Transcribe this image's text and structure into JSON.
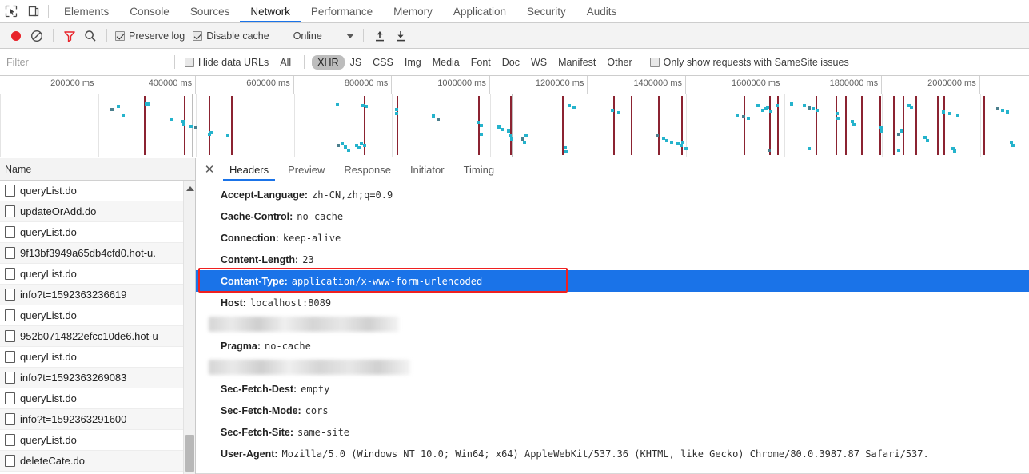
{
  "devtools": {
    "icons": {
      "inspect": "inspect-cursor-icon",
      "device": "device-toolbar-icon"
    },
    "tabs": [
      {
        "label": "Elements",
        "active": false
      },
      {
        "label": "Console",
        "active": false
      },
      {
        "label": "Sources",
        "active": false
      },
      {
        "label": "Network",
        "active": true
      },
      {
        "label": "Performance",
        "active": false
      },
      {
        "label": "Memory",
        "active": false
      },
      {
        "label": "Application",
        "active": false
      },
      {
        "label": "Security",
        "active": false
      },
      {
        "label": "Audits",
        "active": false
      }
    ]
  },
  "toolbar": {
    "record_label": "record-button",
    "clear_label": "clear-button",
    "filter_label": "filter-toggle-button",
    "search_label": "search-button",
    "preserve_log": {
      "label": "Preserve log",
      "checked": true
    },
    "disable_cache": {
      "label": "Disable cache",
      "checked": true
    },
    "throttling": {
      "value": "Online"
    },
    "import_label": "import-har-button",
    "export_label": "export-har-button"
  },
  "filterbar": {
    "placeholder": "Filter",
    "value": "",
    "hide_data_urls": {
      "label": "Hide data URLs",
      "checked": false
    },
    "types": [
      {
        "label": "All",
        "active": false
      },
      {
        "label": "XHR",
        "active": true
      },
      {
        "label": "JS",
        "active": false
      },
      {
        "label": "CSS",
        "active": false
      },
      {
        "label": "Img",
        "active": false
      },
      {
        "label": "Media",
        "active": false
      },
      {
        "label": "Font",
        "active": false
      },
      {
        "label": "Doc",
        "active": false
      },
      {
        "label": "WS",
        "active": false
      },
      {
        "label": "Manifest",
        "active": false
      },
      {
        "label": "Other",
        "active": false
      }
    ],
    "samesite": {
      "label": "Only show requests with SameSite issues",
      "checked": false
    }
  },
  "timeline": {
    "ticks": [
      "200000 ms",
      "400000 ms",
      "600000 ms",
      "800000 ms",
      "1000000 ms",
      "1200000 ms",
      "1400000 ms",
      "1600000 ms",
      "1800000 ms",
      "2000000 ms"
    ],
    "accent_marker_color": "#8b2331",
    "dot_color": "#25b3cc"
  },
  "requests": {
    "column_header": "Name",
    "rows": [
      {
        "name": "queryList.do"
      },
      {
        "name": "updateOrAdd.do"
      },
      {
        "name": "queryList.do"
      },
      {
        "name": "9f13bf3949a65db4cfd0.hot-u."
      },
      {
        "name": "queryList.do"
      },
      {
        "name": "info?t=1592363236619"
      },
      {
        "name": "queryList.do"
      },
      {
        "name": "952b0714822efcc10de6.hot-u"
      },
      {
        "name": "queryList.do"
      },
      {
        "name": "info?t=1592363269083"
      },
      {
        "name": "queryList.do"
      },
      {
        "name": "info?t=1592363291600"
      },
      {
        "name": "queryList.do"
      },
      {
        "name": "deleteCate.do"
      }
    ]
  },
  "detail": {
    "close_label": "✕",
    "tabs": [
      {
        "label": "Headers",
        "active": true
      },
      {
        "label": "Preview",
        "active": false
      },
      {
        "label": "Response",
        "active": false
      },
      {
        "label": "Initiator",
        "active": false
      },
      {
        "label": "Timing",
        "active": false
      }
    ],
    "headers": [
      {
        "name": "Accept-Language:",
        "value": "zh-CN,zh;q=0.9",
        "state": "normal"
      },
      {
        "name": "Cache-Control:",
        "value": "no-cache",
        "state": "normal"
      },
      {
        "name": "Connection:",
        "value": "keep-alive",
        "state": "normal"
      },
      {
        "name": "Content-Length:",
        "value": "23",
        "state": "normal"
      },
      {
        "name": "Content-Type:",
        "value": "application/x-www-form-urlencoded",
        "state": "selected"
      },
      {
        "name": "Host:",
        "value": "localhost:8089",
        "state": "normal"
      },
      {
        "name": "",
        "value": "",
        "state": "redacted",
        "blur_width": 238
      },
      {
        "name": "Pragma:",
        "value": "no-cache",
        "state": "normal"
      },
      {
        "name": "",
        "value": "",
        "state": "redacted",
        "blur_width": 252
      },
      {
        "name": "Sec-Fetch-Dest:",
        "value": "empty",
        "state": "normal"
      },
      {
        "name": "Sec-Fetch-Mode:",
        "value": "cors",
        "state": "normal"
      },
      {
        "name": "Sec-Fetch-Site:",
        "value": "same-site",
        "state": "normal"
      },
      {
        "name": "User-Agent:",
        "value": "Mozilla/5.0 (Windows NT 10.0; Win64; x64) AppleWebKit/537.36 (KHTML, like Gecko) Chrome/80.0.3987.87 Safari/537.",
        "state": "normal"
      }
    ],
    "annotation": {
      "color": "#ef2020",
      "target": "Content-Type"
    }
  }
}
